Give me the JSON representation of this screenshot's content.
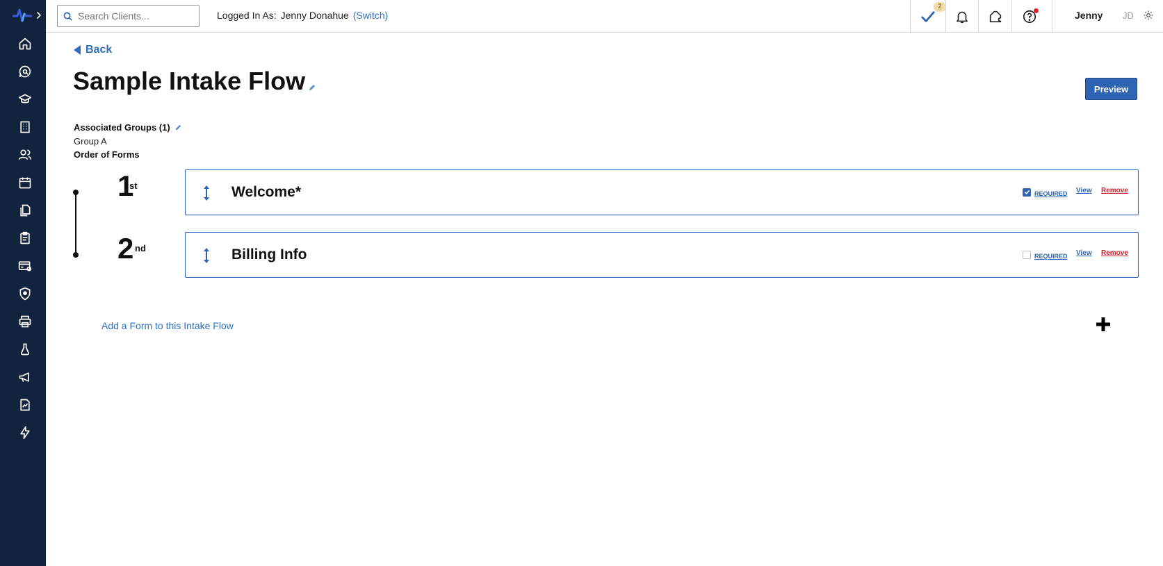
{
  "sidebar": {
    "items": [
      {
        "icon": "home-icon"
      },
      {
        "icon": "search-chat-icon"
      },
      {
        "icon": "graduation-cap-icon"
      },
      {
        "icon": "building-icon"
      },
      {
        "icon": "users-icon"
      },
      {
        "icon": "calendar-icon"
      },
      {
        "icon": "documents-icon"
      },
      {
        "icon": "clipboard-icon"
      },
      {
        "icon": "billing-card-icon"
      },
      {
        "icon": "shield-icon"
      },
      {
        "icon": "printer-icon"
      },
      {
        "icon": "flask-icon"
      },
      {
        "icon": "megaphone-icon"
      },
      {
        "icon": "report-icon"
      },
      {
        "icon": "lightning-icon"
      }
    ]
  },
  "topbar": {
    "search_placeholder": "Search Clients...",
    "logged_in_label": "Logged In As:",
    "logged_in_name": "Jenny Donahue",
    "switch_label": "(Switch)",
    "tasks_count": "2",
    "user_name": "Jenny",
    "user_initials": "JD"
  },
  "page": {
    "back_label": "Back",
    "title": "Sample Intake Flow",
    "preview_label": "Preview",
    "associated_groups_label": "Associated Groups (1)",
    "group_name": "Group A",
    "order_of_forms_label": "Order of Forms",
    "forms": [
      {
        "ordinal": "1",
        "suffix": "st",
        "name": "Welcome*",
        "required": true,
        "required_label": "REQUIRED",
        "view_label": "View",
        "remove_label": "Remove"
      },
      {
        "ordinal": "2",
        "suffix": "nd",
        "name": "Billing Info",
        "required": false,
        "required_label": "REQUIRED",
        "view_label": "View",
        "remove_label": "Remove"
      }
    ],
    "add_form_label": "Add a Form to this Intake Flow"
  },
  "colors": {
    "sidebar_bg": "#13233d",
    "accent": "#2e64b2",
    "link": "#2f6fbe",
    "remove": "#c8232c"
  }
}
